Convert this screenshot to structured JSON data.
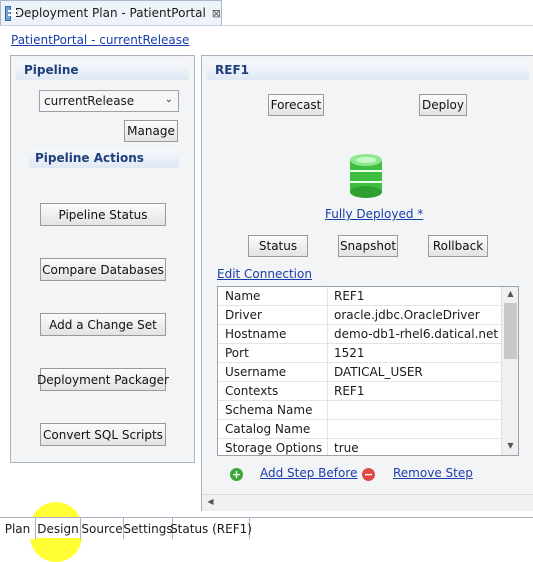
{
  "editor": {
    "title": "Deployment Plan - PatientPortal",
    "close_glyph": "⊠"
  },
  "breadcrumb": "PatientPortal - currentRelease",
  "pipeline": {
    "header": "Pipeline",
    "selected": "currentRelease",
    "manage_label": "Manage",
    "actions_header": "Pipeline Actions",
    "actions": [
      "Pipeline Status",
      "Compare Databases",
      "Add a Change Set",
      "Deployment Packager",
      "Convert SQL Scripts"
    ]
  },
  "ref": {
    "header": "REF1",
    "forecast_label": "Forecast",
    "deploy_label": "Deploy",
    "deploy_status": "Fully Deployed *",
    "status_label": "Status",
    "snapshot_label": "Snapshot",
    "rollback_label": "Rollback",
    "edit_connection": "Edit Connection",
    "properties": [
      {
        "name": "Name",
        "value": "REF1"
      },
      {
        "name": "Driver",
        "value": "oracle.jdbc.OracleDriver"
      },
      {
        "name": "Hostname",
        "value": "demo-db1-rhel6.datical.net"
      },
      {
        "name": "Port",
        "value": "1521"
      },
      {
        "name": "Username",
        "value": "DATICAL_USER"
      },
      {
        "name": "Contexts",
        "value": "REF1"
      },
      {
        "name": "Schema Name",
        "value": ""
      },
      {
        "name": "Catalog Name",
        "value": ""
      },
      {
        "name": "Storage Options",
        "value": "true"
      }
    ],
    "add_step_before": "Add Step Before",
    "remove_step": "Remove Step"
  },
  "bottom_tabs": [
    "Plan",
    "Design",
    "Source",
    "Settings",
    "Status (REF1)"
  ],
  "colors": {
    "highlight": "#ffff33",
    "link": "#1a3eaa",
    "db_icon": "#3fbf3f",
    "add_icon": "#3aa83a",
    "remove_icon": "#e04848"
  }
}
